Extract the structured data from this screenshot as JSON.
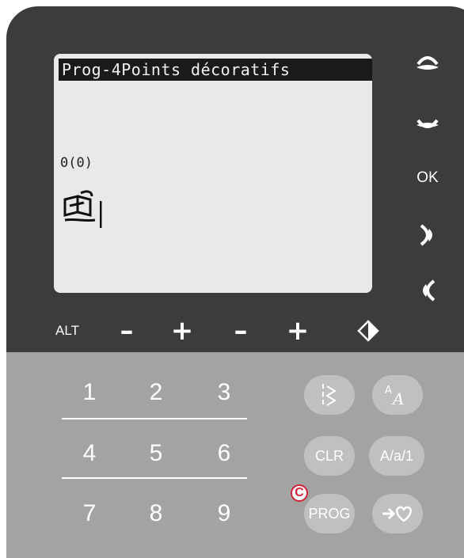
{
  "screen": {
    "title": "Prog-4Points décoratifs",
    "counter": "0(0)"
  },
  "side_buttons": {
    "ok_label": "OK",
    "icons": [
      "scroll-up-icon",
      "scroll-down-icon",
      "step-right-icon",
      "step-left-icon"
    ]
  },
  "control_row": {
    "alt_label": "ALT",
    "minus_1": "–",
    "plus_1": "+",
    "minus_2": "–",
    "plus_2": "+",
    "diamond_icon": "mirror-icon"
  },
  "keypad": {
    "row1": [
      "1",
      "2",
      "3"
    ],
    "row2": [
      "4",
      "5",
      "6"
    ],
    "row3": [
      "7",
      "8",
      "9"
    ]
  },
  "function_keys": {
    "stitch_menu_icon": "stitch-menu-icon",
    "font_icon": "font-menu-icon",
    "clr_label": "CLR",
    "case_label": "A/a/1",
    "prog_label": "PROG",
    "favorites_icon": "save-favorite-icon"
  },
  "marker": {
    "label": "C",
    "color": "#d1243a"
  },
  "colors": {
    "panel_dark": "#3c3c3c",
    "panel_grey": "#a3a3a3",
    "lcd_bg": "#e9e9e9",
    "key_bg": "#c0c0c0"
  }
}
